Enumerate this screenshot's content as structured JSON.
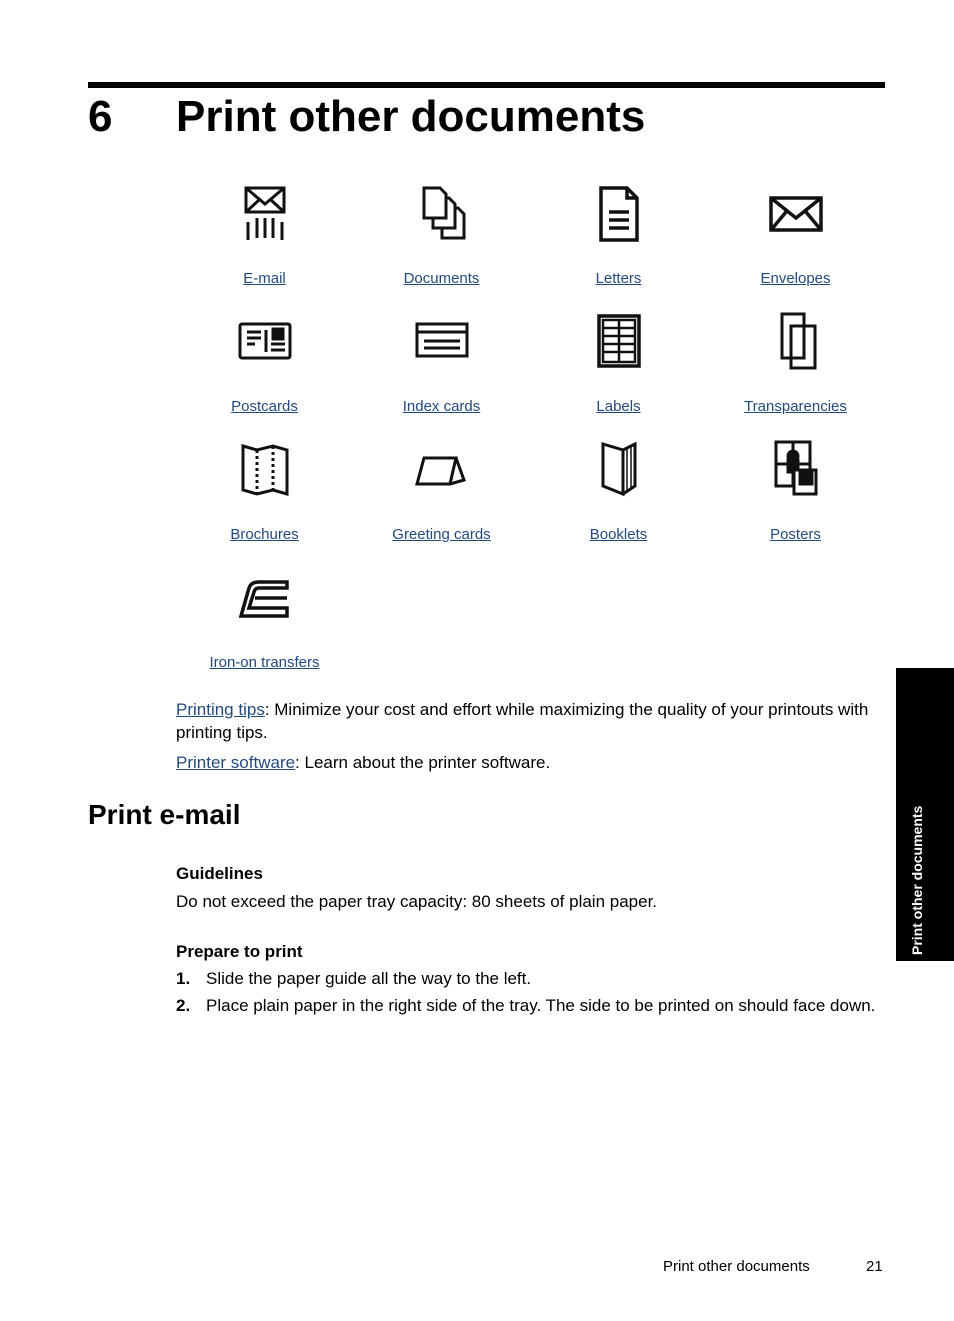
{
  "chapter": {
    "number": "6",
    "title": "Print other documents"
  },
  "document_types": [
    {
      "label": "E-mail",
      "icon": "email-icon"
    },
    {
      "label": "Documents",
      "icon": "documents-icon"
    },
    {
      "label": "Letters",
      "icon": "letter-icon"
    },
    {
      "label": "Envelopes",
      "icon": "envelope-icon"
    },
    {
      "label": "Postcards",
      "icon": "postcard-icon"
    },
    {
      "label": "Index cards",
      "icon": "index-card-icon"
    },
    {
      "label": "Labels",
      "icon": "labels-icon"
    },
    {
      "label": "Transparencies",
      "icon": "transparencies-icon"
    },
    {
      "label": "Brochures",
      "icon": "brochure-icon"
    },
    {
      "label": "Greeting cards",
      "icon": "greeting-card-icon"
    },
    {
      "label": "Booklets",
      "icon": "booklet-icon"
    },
    {
      "label": "Posters",
      "icon": "poster-icon"
    },
    {
      "label": "Iron-on transfers",
      "icon": "iron-icon"
    }
  ],
  "related": [
    {
      "link": "Printing tips",
      "text": ": Minimize your cost and effort while maximizing the quality of your printouts with printing tips."
    },
    {
      "link": "Printer software",
      "text": ": Learn about the printer software."
    }
  ],
  "section": {
    "title": "Print e-mail",
    "guidelines_heading": "Guidelines",
    "guidelines_text": "Do not exceed the paper tray capacity: 80 sheets of plain paper.",
    "prepare_heading": "Prepare to print",
    "steps": [
      {
        "num": "1.",
        "text": "Slide the paper guide all the way to the left."
      },
      {
        "num": "2.",
        "text": "Place plain paper in the right side of the tray. The side to be printed on should face down."
      }
    ]
  },
  "side_tab": "Print other documents",
  "footer": {
    "title": "Print other documents",
    "page": "21"
  }
}
